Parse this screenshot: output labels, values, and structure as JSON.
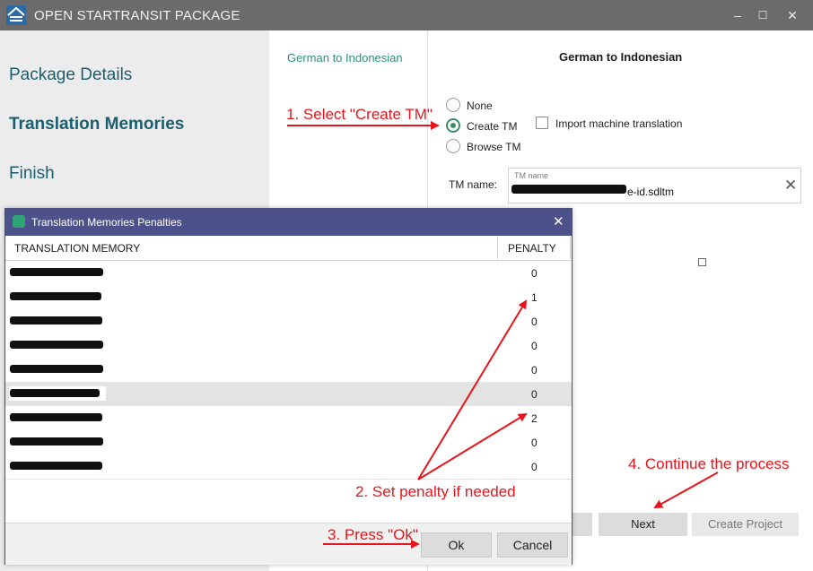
{
  "window": {
    "title": "OPEN STARTRANSIT PACKAGE",
    "minimize_glyph": "–",
    "maximize_glyph": "☐",
    "close_glyph": "✕"
  },
  "sidebar": {
    "items": [
      {
        "label": "Package Details"
      },
      {
        "label": "Translation Memories"
      },
      {
        "label": "Finish"
      }
    ]
  },
  "middle": {
    "language_pair": "German  to Indonesian"
  },
  "right": {
    "language_pair": "German  to Indonesian",
    "options": [
      {
        "label": "None",
        "checked": false
      },
      {
        "label": "Create TM",
        "checked": true
      },
      {
        "label": "Browse TM",
        "checked": false
      }
    ],
    "import_mt_label": "Import machine translation",
    "tm_name_label": "TM name:",
    "tm_name_caption": "TM name",
    "tm_name_value_visible": "e-id.sdltm"
  },
  "footer": {
    "back_label": "",
    "next_label": "Next",
    "create_label": "Create Project"
  },
  "dialog": {
    "title": "Translation Memories Penalties",
    "columns": [
      "TRANSLATION MEMORY",
      "PENALTY"
    ],
    "rows": [
      {
        "penalty": "0"
      },
      {
        "penalty": "1"
      },
      {
        "penalty": "0"
      },
      {
        "penalty": "0"
      },
      {
        "penalty": "0"
      },
      {
        "penalty": "0",
        "selected": true
      },
      {
        "penalty": "2"
      },
      {
        "penalty": "0"
      },
      {
        "penalty": "0"
      }
    ],
    "ok_label": "Ok",
    "cancel_label": "Cancel"
  },
  "annotations": {
    "step1": "1. Select \"Create TM\"",
    "step2": "2. Set penalty if needed",
    "step3": "3. Press \"Ok\"",
    "step4": "4. Continue the process"
  },
  "colors": {
    "titlebar": "#6b6b6b",
    "sidebar_bg": "#ececec",
    "sidebar_text": "#1c5e6e",
    "accent_green": "#3d8c63",
    "dialog_header": "#4d5189",
    "annotation_red": "#e8141b"
  }
}
